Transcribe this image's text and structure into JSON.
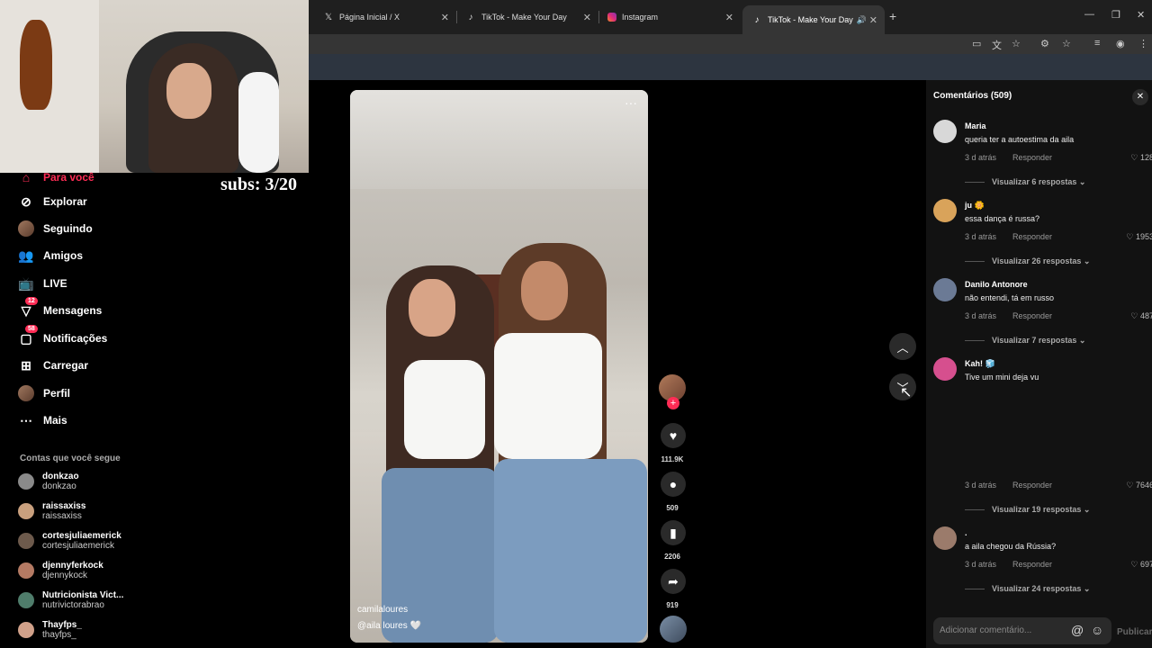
{
  "browser": {
    "tabs": [
      {
        "label": "Página Inicial / X",
        "icon": "x-logo-icon"
      },
      {
        "label": "TikTok - Make Your Day",
        "icon": "tiktok-icon"
      },
      {
        "label": "Instagram",
        "icon": "instagram-icon"
      },
      {
        "label": "TikTok - Make Your Day",
        "icon": "tiktok-icon",
        "active": true
      }
    ]
  },
  "overlay": {
    "subs": "subs: 3/20"
  },
  "nav": {
    "items": [
      {
        "label": "Para você",
        "icon": "home-icon"
      },
      {
        "label": "Explorar",
        "icon": "compass-icon"
      },
      {
        "label": "Seguindo",
        "icon": "avatar"
      },
      {
        "label": "Amigos",
        "icon": "friends-icon"
      },
      {
        "label": "LIVE",
        "icon": "live-icon"
      },
      {
        "label": "Mensagens",
        "icon": "messages-icon",
        "badge": "12"
      },
      {
        "label": "Notificações",
        "icon": "notifications-icon",
        "badge": "58"
      },
      {
        "label": "Carregar",
        "icon": "upload-icon"
      },
      {
        "label": "Perfil",
        "icon": "avatar"
      },
      {
        "label": "Mais",
        "icon": "more-icon"
      }
    ],
    "following_title": "Contas que você segue",
    "following": [
      {
        "name": "donkzao",
        "handle": "donkzao",
        "color": "#8a8a8a"
      },
      {
        "name": "raissaxiss",
        "handle": "raissaxiss",
        "color": "#c9a07e"
      },
      {
        "name": "cortesjuliaemerick",
        "handle": "cortesjuliaemerick",
        "color": "#6d5a4c"
      },
      {
        "name": "djennyferkock",
        "handle": "djennykock",
        "color": "#b47a63"
      },
      {
        "name": "Nutricionista Vict...",
        "handle": "nutrivictorabrao",
        "color": "#4f7d6b"
      },
      {
        "name": "Thayfps_",
        "handle": "thayfps_",
        "color": "#d1a18a"
      }
    ]
  },
  "video": {
    "caption_user": "camilaloures",
    "caption_text": "@aila loures 🤍"
  },
  "actions": {
    "likes": "111.9K",
    "comments": "509",
    "saves": "2206",
    "shares": "919"
  },
  "comments": {
    "title": "Comentários (509)",
    "items": [
      {
        "user": "Maria",
        "text": "queria ter a autoestima da aila",
        "time": "3 d atrás",
        "reply": "Responder",
        "likes": "128",
        "view": "Visualizar 6 respostas",
        "color": "#d8d8d8"
      },
      {
        "user": "ju 🌼",
        "text": "essa dança é russa?",
        "time": "3 d atrás",
        "reply": "Responder",
        "likes": "1953",
        "view": "Visualizar 26 respostas",
        "color": "#d9a35a"
      },
      {
        "user": "Danilo Antonore",
        "text": "não entendi, tá em russo",
        "time": "3 d atrás",
        "reply": "Responder",
        "likes": "487",
        "view": "Visualizar 7 respostas",
        "color": "#6b7a95"
      },
      {
        "user": "Kah! 🧊",
        "text": "Tive um mini deja vu",
        "time": "3 d atrás",
        "reply": "Responder",
        "likes": "7646",
        "view": "Visualizar 19 respostas",
        "color": "#d64f8e"
      },
      {
        "user": ".",
        "text": "a aila chegou da Rússia?",
        "time": "3 d atrás",
        "reply": "Responder",
        "likes": "697",
        "view": "Visualizar 24 respostas",
        "color": "#9b7b6b"
      }
    ],
    "input_placeholder": "Adicionar comentário...",
    "publish": "Publicar"
  }
}
